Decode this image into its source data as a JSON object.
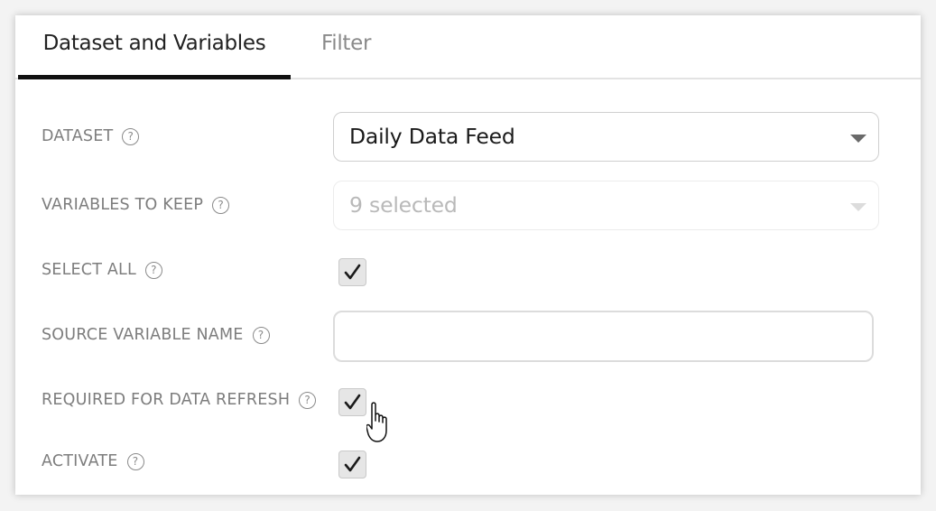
{
  "tabs": [
    {
      "label": "Dataset and Variables",
      "active": true
    },
    {
      "label": "Filter",
      "active": false
    }
  ],
  "fields": {
    "dataset": {
      "label": "DATASET",
      "value": "Daily Data Feed"
    },
    "variables_to_keep": {
      "label": "VARIABLES TO KEEP",
      "value": "9 selected",
      "disabled": true
    },
    "select_all": {
      "label": "SELECT ALL",
      "checked": true
    },
    "source_variable_name": {
      "label": "SOURCE VARIABLE NAME",
      "value": "",
      "placeholder": ""
    },
    "required_for_data_refresh": {
      "label": "REQUIRED FOR DATA REFRESH",
      "checked": true
    },
    "activate": {
      "label": "ACTIVATE",
      "checked": true
    }
  },
  "help_icon_glyph": "?",
  "colors": {
    "active_tab_underline": "#111111",
    "label_text": "#7d7d7d",
    "checkbox_fill": "#e6e6e6"
  }
}
